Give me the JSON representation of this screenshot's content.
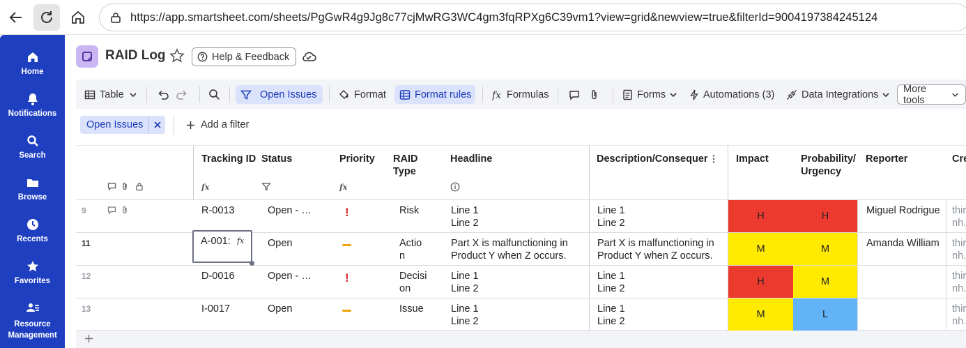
{
  "browser": {
    "url": "https://app.smartsheet.com/sheets/PgGwR4g9Jg8c77cjMwRG3WC4gm3fqRPXg6C39vm1?view=grid&newview=true&filterId=9004197384245124"
  },
  "leftnav": {
    "items": [
      {
        "label": "Home",
        "icon": "home-icon"
      },
      {
        "label": "Notifications",
        "icon": "bell-icon"
      },
      {
        "label": "Search",
        "icon": "search-icon"
      },
      {
        "label": "Browse",
        "icon": "folder-icon"
      },
      {
        "label": "Recents",
        "icon": "clock-icon"
      },
      {
        "label": "Favorites",
        "icon": "star-icon"
      },
      {
        "label": "Resource Management",
        "icon": "people-icon"
      }
    ]
  },
  "sheet": {
    "title": "RAID Log",
    "help_label": "Help & Feedback"
  },
  "toolbar": {
    "table_label": "Table",
    "open_issues_label": "Open Issues",
    "format_label": "Format",
    "format_rules_label": "Format rules",
    "formulas_label": "Formulas",
    "forms_label": "Forms",
    "automations_label": "Automations (3)",
    "integrations_label": "Data Integrations",
    "more_tools_label": "More tools"
  },
  "filterbar": {
    "chip_label": "Open Issues",
    "add_filter_label": "Add a filter"
  },
  "grid": {
    "columns": {
      "tracking_id": "Tracking ID",
      "status": "Status",
      "priority": "Priority",
      "raid_type": "RAID Type",
      "headline": "Headline",
      "description": "Description/Consequer",
      "impact": "Impact",
      "probability": "Probability/ Urgency",
      "reporter": "Reporter",
      "created": "Cre"
    },
    "rows": [
      {
        "num": "9",
        "tracking_id": "R-0013",
        "status": "Open - …",
        "priority": "high",
        "raid_type": "Risk",
        "headline_1": "Line 1",
        "headline_2": "Line 2",
        "desc_1": "Line 1",
        "desc_2": "Line 2",
        "impact": "H",
        "probability": "H",
        "reporter": "Miguel Rodrigue",
        "created_1": "thir",
        "created_2": "nh."
      },
      {
        "num": "11",
        "tracking_id": "A-001:",
        "status": "Open",
        "priority": "medium",
        "raid_type": "Actio n",
        "headline_1": "Part X is malfunctioning in",
        "headline_2": "Product Y when Z occurs.",
        "desc_1": "Part X is malfunctioning in",
        "desc_2": "Product Y when Z occurs.",
        "impact": "M",
        "probability": "M",
        "reporter": "Amanda William",
        "created_1": "thir",
        "created_2": "nh."
      },
      {
        "num": "12",
        "tracking_id": "D-0016",
        "status": "Open - …",
        "priority": "high",
        "raid_type": "Decisi on",
        "headline_1": "Line 1",
        "headline_2": "Line 2",
        "desc_1": "Line 1",
        "desc_2": "Line 2",
        "impact": "H",
        "probability": "M",
        "reporter": "",
        "created_1": "thir",
        "created_2": "nh."
      },
      {
        "num": "13",
        "tracking_id": "I-0017",
        "status": "Open",
        "priority": "medium",
        "raid_type": "Issue",
        "headline_1": "Line 1",
        "headline_2": "Line 2",
        "desc_1": "Line 1",
        "desc_2": "Line 2",
        "impact": "M",
        "probability": "L",
        "reporter": "",
        "created_1": "thir",
        "created_2": "nh."
      }
    ]
  },
  "colors": {
    "nav_bg": "#1f3fc1",
    "H": "#ec3a2f",
    "M": "#ffea00",
    "L": "#63b3f7",
    "accent": "#1b3bb8"
  }
}
